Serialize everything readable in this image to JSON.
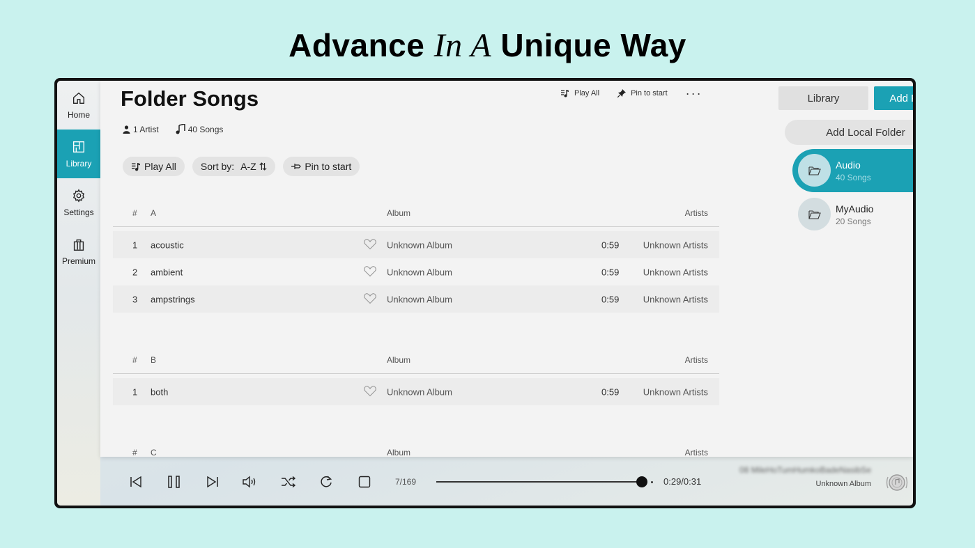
{
  "headline": {
    "part1": "Advance",
    "part2": "In A",
    "part3": "Unique Way"
  },
  "nav": [
    {
      "label": "Home",
      "icon": "home-icon"
    },
    {
      "label": "Library",
      "icon": "library-icon",
      "active": true
    },
    {
      "label": "Settings",
      "icon": "gear-icon"
    },
    {
      "label": "Premium",
      "icon": "shopping-bag-icon"
    }
  ],
  "header": {
    "title": "Folder Songs",
    "artists": "1 Artist",
    "songs": "40 Songs",
    "play_all": "Play All",
    "pin_to_start": "Pin to start",
    "more": "···"
  },
  "toolbar": {
    "play_all": "Play All",
    "sort_by": "Sort by:",
    "sort_value": "A-Z ⇅",
    "pin_to_start": "Pin to start"
  },
  "columns": {
    "num": "#",
    "album": "Album",
    "artists": "Artists"
  },
  "groups": [
    {
      "letter": "A",
      "rows": [
        {
          "num": "1",
          "title": "acoustic",
          "album": "Unknown Album",
          "duration": "0:59",
          "artist": "Unknown Artists"
        },
        {
          "num": "2",
          "title": "ambient",
          "album": "Unknown Album",
          "duration": "0:59",
          "artist": "Unknown Artists"
        },
        {
          "num": "3",
          "title": "ampstrings",
          "album": "Unknown Album",
          "duration": "0:59",
          "artist": "Unknown Artists"
        }
      ]
    },
    {
      "letter": "B",
      "rows": [
        {
          "num": "1",
          "title": "both",
          "album": "Unknown Album",
          "duration": "0:59",
          "artist": "Unknown Artists"
        }
      ]
    },
    {
      "letter": "C",
      "rows": []
    }
  ],
  "side": {
    "library": "Library",
    "add_folder": "Add Folder",
    "add_local_folder": "Add Local Folder",
    "folders": [
      {
        "name": "Audio",
        "count": "40 Songs",
        "active": true
      },
      {
        "name": "MyAudio",
        "count": "20 Songs",
        "active": false
      }
    ]
  },
  "player": {
    "position": "7/169",
    "time": "0:29/0:31",
    "progress": 0.94,
    "song": "08 MileHoTumHumkoBadeNasibSe",
    "album": "Unknown Album"
  },
  "colors": {
    "accent": "#1ba1b4",
    "background": "#c9f2ee"
  }
}
